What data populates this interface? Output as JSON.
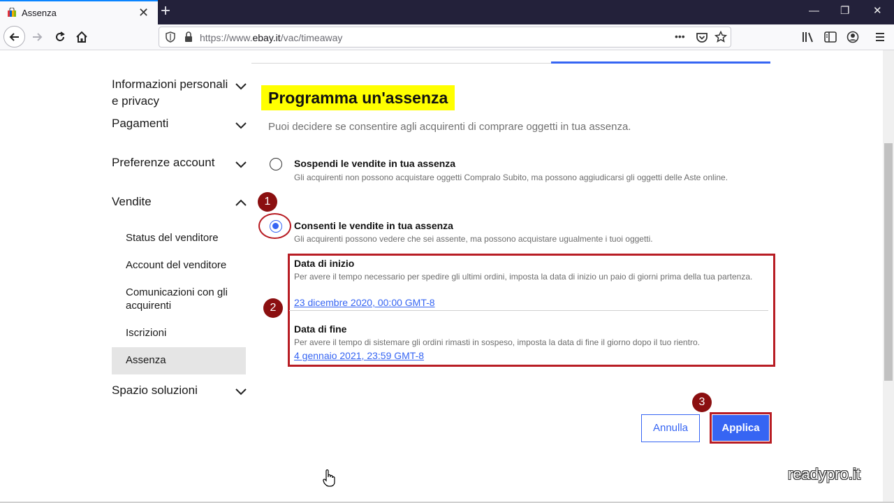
{
  "browser": {
    "tab_title": "Assenza",
    "tab_close": "✕",
    "new_tab": "+",
    "url_prefix": "https://www.",
    "url_host": "ebay.it",
    "url_path": "/vac/timeaway",
    "url_more": "•••",
    "window_min": "—",
    "window_restore": "❐",
    "window_close": "✕"
  },
  "sidebar": {
    "items": [
      {
        "label": "Informazioni personali\ne privacy",
        "expanded": false
      },
      {
        "label": "Pagamenti",
        "expanded": false
      },
      {
        "label": "Preferenze account",
        "expanded": false
      },
      {
        "label": "Vendite",
        "expanded": true
      },
      {
        "label": "Spazio soluzioni",
        "expanded": false
      }
    ],
    "vendite_sub": [
      {
        "label": "Status del venditore"
      },
      {
        "label": "Account del venditore"
      },
      {
        "label": "Comunicazioni con gli\nacquirenti"
      },
      {
        "label": "Iscrizioni"
      },
      {
        "label": "Assenza",
        "active": true
      }
    ]
  },
  "main": {
    "heading": "Programma un'assenza",
    "intro": "Puoi decidere se consentire agli acquirenti di comprare oggetti in tua assenza.",
    "option_suspend": {
      "title": "Sospendi le vendite in tua assenza",
      "desc": "Gli acquirenti non possono acquistare oggetti Compralo Subito, ma possono aggiudicarsi gli oggetti delle Aste online.",
      "selected": false
    },
    "option_allow": {
      "title": "Consenti le vendite in tua assenza",
      "desc": "Gli acquirenti possono vedere che sei assente, ma possono acquistare ugualmente i tuoi oggetti.",
      "selected": true
    },
    "start": {
      "title": "Data di inizio",
      "desc": "Per avere il tempo necessario per spedire gli ultimi ordini, imposta la data di inizio un paio di giorni prima della tua partenza.",
      "value": "23 dicembre 2020, 00:00 GMT-8"
    },
    "end": {
      "title": "Data di fine",
      "desc": "Per avere il tempo di sistemare gli ordini rimasti in sospeso, imposta la data di fine il giorno dopo il tuo rientro.",
      "value": "4 gennaio 2021, 23:59 GMT-8"
    },
    "cancel_label": "Annulla",
    "apply_label": "Applica"
  },
  "annotations": {
    "step1": "1",
    "step2": "2",
    "step3": "3",
    "highlight_color": "#ffff00",
    "marker_color": "#b81d24"
  },
  "watermark": "readypro.it",
  "colors": {
    "accent": "#3665f3",
    "tabbar": "#23213a"
  }
}
